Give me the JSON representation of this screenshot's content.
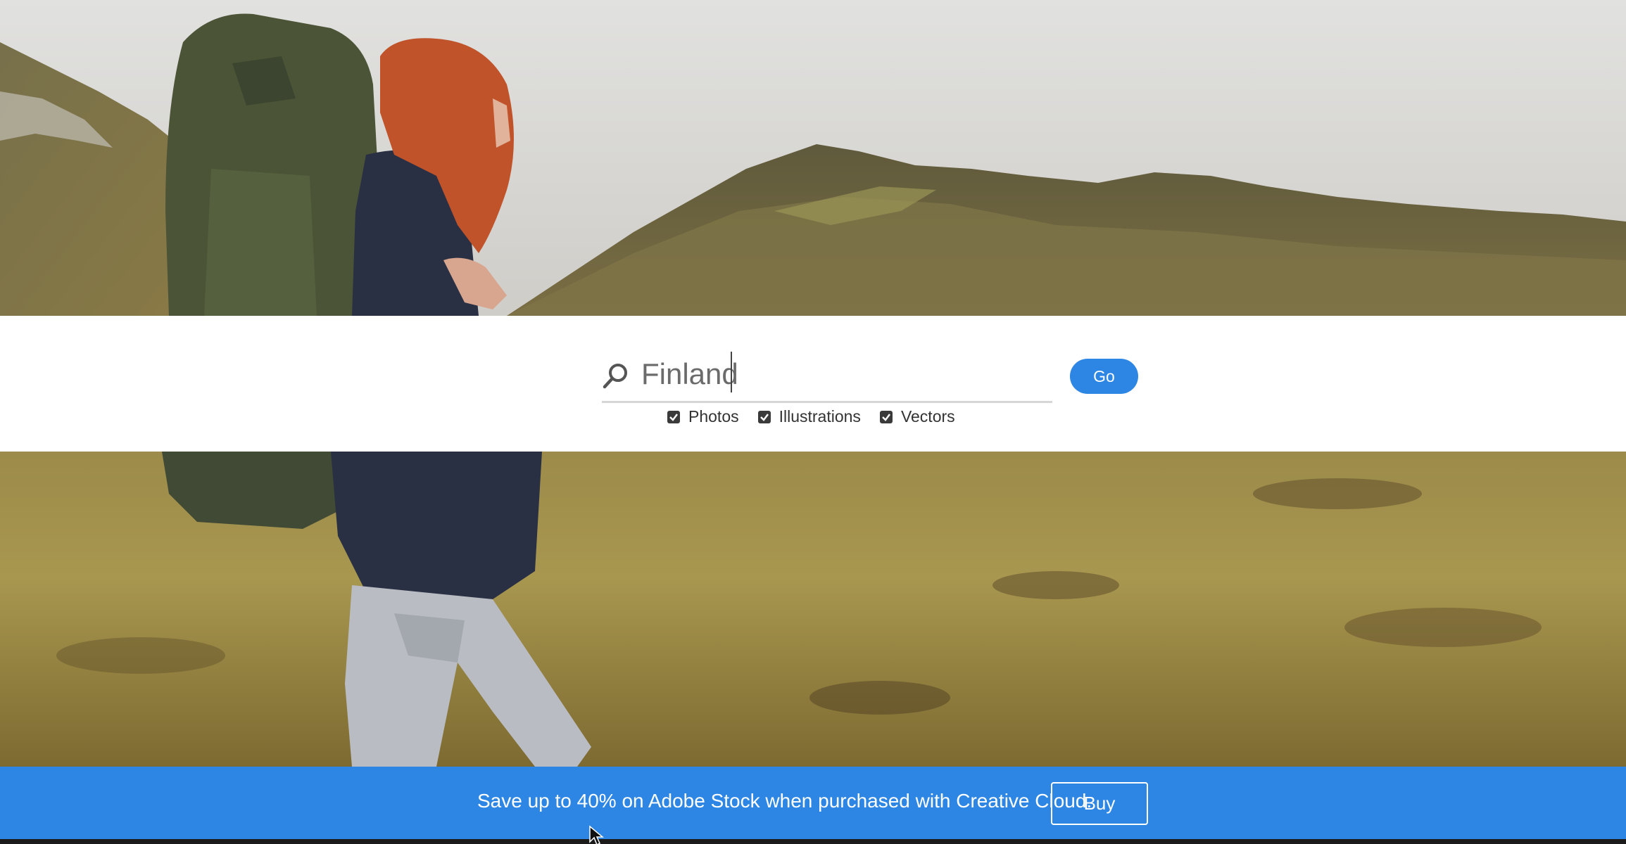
{
  "hero": {
    "image": "hiker-in-mountains-photo"
  },
  "search": {
    "icon": "search-icon",
    "value": "Finland",
    "go_label": "Go"
  },
  "filters": [
    {
      "label": "Photos",
      "checked": true
    },
    {
      "label": "Illustrations",
      "checked": true
    },
    {
      "label": "Vectors",
      "checked": true
    }
  ],
  "promo": {
    "text": "Save up to 40% on Adobe Stock when purchased with Creative Cloud.",
    "buy_label": "Buy"
  },
  "colors": {
    "accent": "#2d86e4",
    "band": "#ffffff"
  }
}
